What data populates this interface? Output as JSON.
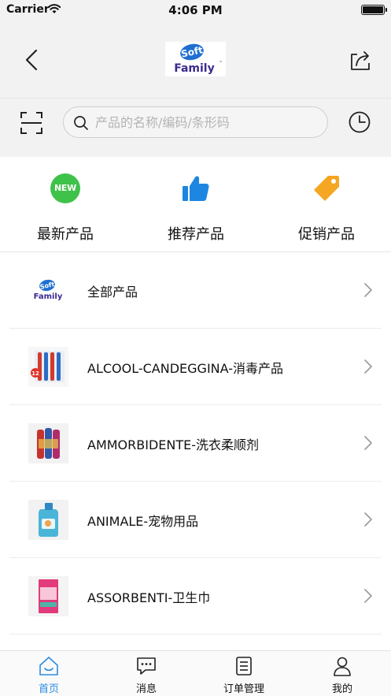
{
  "status_bar": {
    "carrier": "Carrier",
    "time": "4:06 PM"
  },
  "header": {
    "back_icon": "chevron-left-icon",
    "logo_line1": "Soft",
    "logo_line2": "Family",
    "logo_tm": "™",
    "share_icon": "share-icon"
  },
  "search": {
    "scan_icon": "scan-icon",
    "placeholder": "产品的名称/编码/条形码",
    "value": "",
    "history_icon": "clock-icon"
  },
  "quick_links": [
    {
      "label": "最新产品",
      "icon": "new-badge-icon",
      "badge_text": "NEW",
      "color": "#3fc24a"
    },
    {
      "label": "推荐产品",
      "icon": "thumbs-up-icon",
      "color": "#1d86e0"
    },
    {
      "label": "促销产品",
      "icon": "price-tag-icon",
      "color": "#f5a623"
    }
  ],
  "categories": [
    {
      "label": "全部产品",
      "thumb": "soft-family-logo"
    },
    {
      "label": "ALCOOL-CANDEGGINA-消毒产品",
      "thumb": "toothbrush-pack",
      "thumb_badge": "12"
    },
    {
      "label": "AMMORBIDENTE-洗衣柔顺剂",
      "thumb": "softener-bottles"
    },
    {
      "label": "ANIMALE-宠物用品",
      "thumb": "pet-detergent-bottle"
    },
    {
      "label": "ASSORBENTI-卫生巾",
      "thumb": "sanitary-pads-pack"
    }
  ],
  "tabbar": {
    "active_color": "#2a8be0",
    "tabs": [
      {
        "label": "首页",
        "icon": "home-icon",
        "active": true
      },
      {
        "label": "消息",
        "icon": "message-icon",
        "active": false
      },
      {
        "label": "订单管理",
        "icon": "order-list-icon",
        "active": false
      },
      {
        "label": "我的",
        "icon": "user-icon",
        "active": false
      }
    ]
  }
}
